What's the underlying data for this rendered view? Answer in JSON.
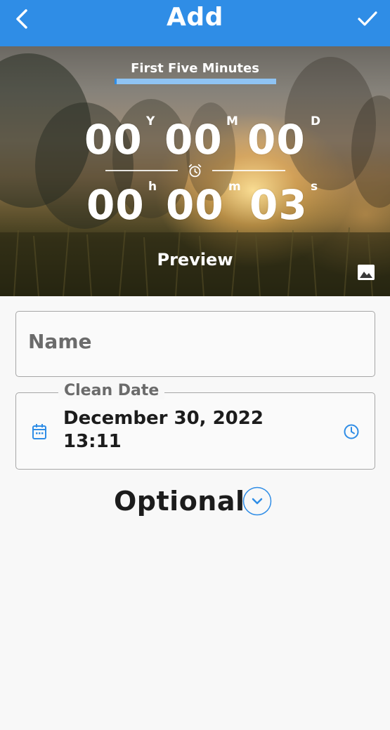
{
  "appbar": {
    "title": "Add",
    "back_icon": "chevron-left-icon",
    "done_icon": "check-icon",
    "color": "#2f8de6"
  },
  "preview_card": {
    "title": "First Five Minutes",
    "years": "00",
    "years_unit": "Y",
    "months": "00",
    "months_unit": "M",
    "days": "00",
    "days_unit": "D",
    "hours": "00",
    "hours_unit": "h",
    "minutes": "00",
    "minutes_unit": "m",
    "seconds": "03",
    "seconds_unit": "s",
    "preview_label": "Preview",
    "alarm_icon": "alarm-clock-icon",
    "image_icon": "image-icon",
    "title_bar_color": "#8fc3f3"
  },
  "form": {
    "name_placeholder": "Name",
    "clean_date_label": "Clean Date",
    "clean_date_value": "December 30, 2022",
    "clean_time_value": "13:11",
    "optional_label": "Optional"
  }
}
